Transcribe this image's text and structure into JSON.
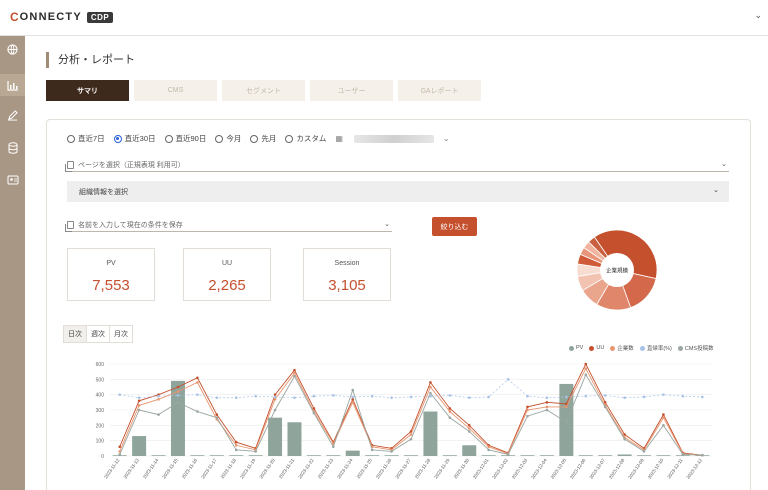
{
  "app": {
    "logo_c": "C",
    "logo_text": "ONNECTY",
    "logo_badge": "CDP"
  },
  "page_title": "分析・レポート",
  "tabs": [
    {
      "label": "サマリ",
      "active": true
    },
    {
      "label": "CMS",
      "active": false
    },
    {
      "label": "セグメント",
      "active": false
    },
    {
      "label": "ユーザー",
      "active": false
    },
    {
      "label": "GAレポート",
      "active": false
    }
  ],
  "date_range": {
    "options": [
      "直近7日",
      "直近30日",
      "直近90日",
      "今月",
      "先月",
      "カスタム"
    ],
    "selected": "直近30日"
  },
  "page_select": {
    "placeholder": "ページを選択（正規表現 利用可）"
  },
  "org_select": {
    "label": "組織情報を選択"
  },
  "saved_condition": {
    "placeholder": "名前を入力して現在の条件を保存"
  },
  "filter_button": "絞り込む",
  "kpis": [
    {
      "label": "PV",
      "value": "7,553"
    },
    {
      "label": "UU",
      "value": "2,265"
    },
    {
      "label": "Session",
      "value": "3,105"
    }
  ],
  "donut": {
    "center_label": "企業規模",
    "slice_colors": [
      "#c4502d",
      "#d4684a",
      "#e0876b",
      "#eaa58d",
      "#f2c3b1",
      "#f7dcd1",
      "#d05a38",
      "#e8957a",
      "#f0b49f",
      "#c96040"
    ],
    "slices": [
      38,
      16,
      14,
      8,
      6,
      5,
      4,
      3,
      3,
      3
    ]
  },
  "period_buttons": [
    {
      "label": "日次",
      "active": true
    },
    {
      "label": "週次",
      "active": false
    },
    {
      "label": "月次",
      "active": false
    }
  ],
  "legend": [
    {
      "label": "PV",
      "color": "#8fa59b"
    },
    {
      "label": "UU",
      "color": "#c4502d"
    },
    {
      "label": "企業数",
      "color": "#e8956f"
    },
    {
      "label": "直帰率(%)",
      "color": "#a9c3e6"
    },
    {
      "label": "CMS投稿数",
      "color": "#9aa6a0"
    }
  ],
  "chart_data": {
    "type": "bar",
    "yticks": [
      "0",
      "100",
      "200",
      "300",
      "400",
      "500",
      "600"
    ],
    "ylim": [
      0,
      600
    ],
    "categories": [
      "2023-11-12",
      "2023-11-13",
      "2023-11-14",
      "2023-11-15",
      "2023-11-16",
      "2023-11-17",
      "2023-11-18",
      "2023-11-19",
      "2023-11-20",
      "2023-11-21",
      "2023-11-22",
      "2023-11-23",
      "2023-11-24",
      "2023-11-25",
      "2023-11-26",
      "2023-11-27",
      "2023-11-28",
      "2023-11-29",
      "2023-11-30",
      "2023-12-01",
      "2023-12-02",
      "2023-12-03",
      "2023-12-04",
      "2023-12-05",
      "2023-12-06",
      "2023-12-07",
      "2023-12-08",
      "2023-12-09",
      "2023-12-10",
      "2023-12-11",
      "2023-12-12"
    ],
    "series": [
      {
        "name": "PV",
        "kind": "bar",
        "values": [
          5,
          130,
          5,
          490,
          5,
          5,
          5,
          5,
          250,
          220,
          5,
          5,
          35,
          5,
          5,
          5,
          290,
          5,
          70,
          5,
          5,
          5,
          5,
          470,
          5,
          5,
          10,
          5,
          5,
          5,
          5
        ]
      },
      {
        "name": "UU",
        "kind": "line",
        "values": [
          60,
          360,
          400,
          450,
          510,
          270,
          90,
          50,
          400,
          560,
          310,
          90,
          370,
          70,
          50,
          160,
          480,
          310,
          200,
          70,
          20,
          320,
          350,
          340,
          600,
          350,
          140,
          50,
          270,
          20,
          5
        ]
      },
      {
        "name": "企業数",
        "kind": "line",
        "values": [
          30,
          330,
          370,
          420,
          480,
          240,
          70,
          40,
          370,
          540,
          290,
          80,
          350,
          60,
          40,
          140,
          450,
          290,
          180,
          60,
          15,
          300,
          320,
          320,
          570,
          330,
          120,
          40,
          250,
          15,
          5
        ]
      },
      {
        "name": "直帰率(%)",
        "kind": "line",
        "values": [
          400,
          380,
          390,
          395,
          400,
          380,
          380,
          390,
          385,
          380,
          390,
          395,
          385,
          390,
          380,
          385,
          390,
          395,
          380,
          385,
          500,
          390,
          380,
          385,
          390,
          395,
          380,
          385,
          400,
          390,
          385
        ]
      },
      {
        "name": "CMS投稿数",
        "kind": "line",
        "values": [
          10,
          300,
          270,
          350,
          290,
          250,
          40,
          30,
          300,
          520,
          280,
          60,
          430,
          40,
          30,
          110,
          410,
          250,
          160,
          40,
          10,
          260,
          300,
          220,
          530,
          320,
          110,
          30,
          200,
          10,
          5
        ]
      }
    ]
  }
}
